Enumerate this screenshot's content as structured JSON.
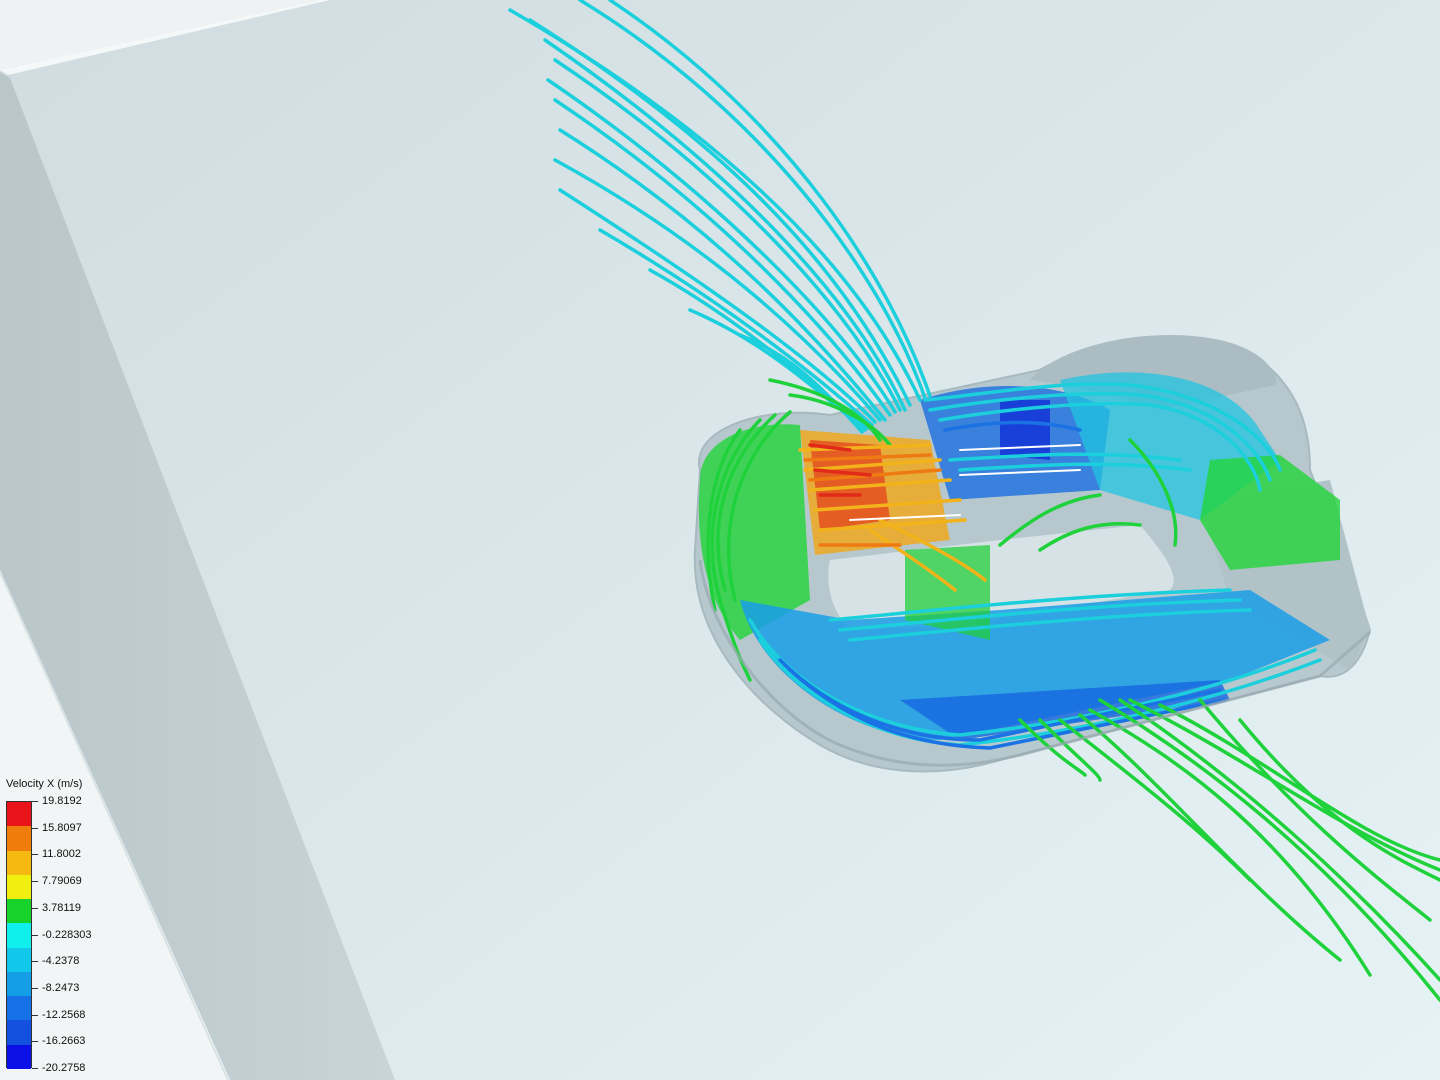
{
  "legend": {
    "title": "Velocity X (m/s)",
    "labels": [
      "19.8192",
      "15.8097",
      "11.8002",
      "7.79069",
      "3.78119",
      "-0.228303",
      "-4.2378",
      "-8.2473",
      "-12.2568",
      "-16.2663",
      "-20.2758"
    ],
    "colors": [
      "#e8141a",
      "#ee7d0c",
      "#f5b912",
      "#f0ef10",
      "#17d22a",
      "#0ff0ec",
      "#12c8ea",
      "#149ee8",
      "#1670e6",
      "#1450e0",
      "#0a10e6"
    ]
  },
  "scene": {
    "background": "#dfe9ec",
    "plate_color": "#cfdde1",
    "housing_color": "#a9bac0"
  }
}
